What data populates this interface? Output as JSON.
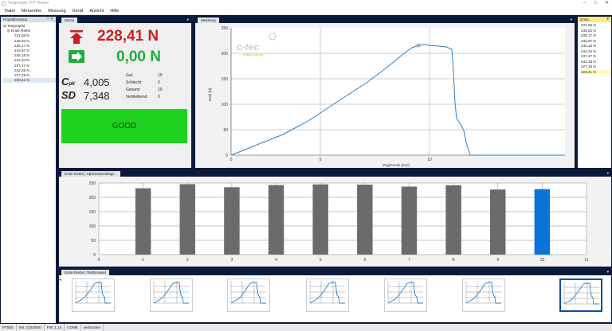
{
  "window": {
    "title": "Testprojekt | PT Viewer"
  },
  "menu": [
    "Datei",
    "Messreihe",
    "Messung",
    "Gerät",
    "Ansicht",
    "Hilfe"
  ],
  "project": {
    "title": "Projektbrowser",
    "root": "Testprojekt",
    "series": "Erste Reihe",
    "items": [
      "231,66 N",
      "246,02 N",
      "235,17 N",
      "242,87 N",
      "245,15 N",
      "244,34 N",
      "237,47 N",
      "242,28 N",
      "227,18 N",
      "228,41 N"
    ]
  },
  "werte": {
    "tab": "Werte",
    "max_value": "228,41 N",
    "end_value": "0,00 N",
    "cpk_label": "C",
    "cpk_sub": "pK",
    "cpk_value": "4,005",
    "sd_label": "SD",
    "sd_value": "7,348",
    "stats": [
      {
        "label": "Gut",
        "value": "10"
      },
      {
        "label": "Schlecht",
        "value": "0"
      },
      {
        "label": "Gesamt",
        "value": "10"
      },
      {
        "label": "Verbleibend",
        "value": "0"
      }
    ],
    "result": "GOOD"
  },
  "messung": {
    "tab": "Messung",
    "logo": "c-tec",
    "logo_sub": "testing | training",
    "ylabel": "Kraft [N]",
    "xlabel": "Zugstrecke [mm]",
    "yticks": [
      "0",
      "50",
      "100",
      "150",
      "200",
      "250"
    ],
    "xticks": [
      "0",
      "5",
      "10"
    ]
  },
  "erste_list": {
    "tab": "Erste...",
    "values": [
      "231,66 N",
      "246,02 N",
      "235,17 N",
      "242,87 N",
      "245,15 N",
      "244,34 N",
      "237,47 N",
      "242,28 N",
      "227,18 N",
      "228,41 N"
    ]
  },
  "peak_panel": {
    "tab": "Erste Reihe | Spitzenwertdiagr..."
  },
  "test_panel": {
    "tab": "Erste Reihe | Testbrowser"
  },
  "chart_data": {
    "type": "bar",
    "categories": [
      "1",
      "2",
      "3",
      "4",
      "5",
      "6",
      "7",
      "8",
      "9",
      "10"
    ],
    "values": [
      231.66,
      246.02,
      235.17,
      242.87,
      245.15,
      244.34,
      237.47,
      242.28,
      227.18,
      228.41
    ],
    "ylim": [
      0,
      250
    ],
    "xlim": [
      0,
      11
    ],
    "yticks": [
      "0",
      "50",
      "100",
      "150",
      "200",
      "250"
    ],
    "xticks": [
      "0",
      "1",
      "2",
      "3",
      "4",
      "5",
      "6",
      "7",
      "8",
      "9",
      "10",
      "11"
    ],
    "bar_color": "#6b6b6b",
    "highlight_color": "#0a74d6",
    "highlight_index": 9,
    "grid": true
  },
  "status": [
    "PT500",
    "SN: 2103/000",
    "FW: 1.14",
    "COM6",
    "verbunden"
  ],
  "colors": {
    "max": "#cc1f1f",
    "end": "#1fae3a",
    "good": "#1ed21e",
    "dark": "#0b1a3a"
  }
}
